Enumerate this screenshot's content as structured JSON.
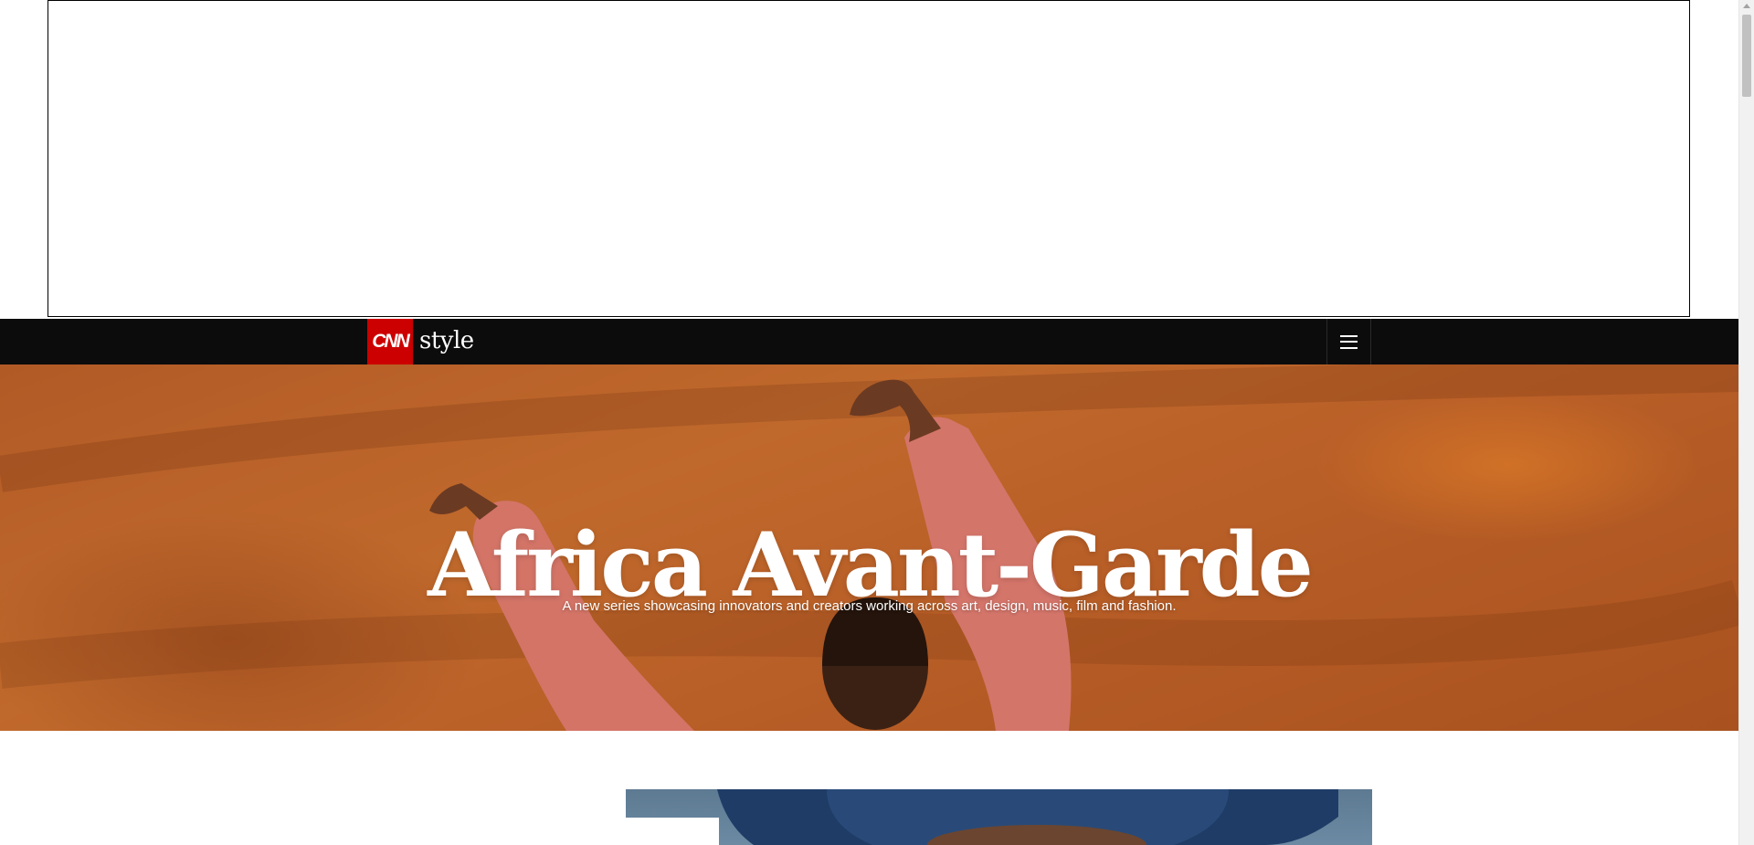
{
  "header": {
    "brand_logo_text": "CNN",
    "brand_section": "style"
  },
  "nav": {
    "menu_icon": "hamburger-menu-icon"
  },
  "hero": {
    "title": "Africa Avant-Garde",
    "subtitle": "A new series showcasing innovators and creators working across art, design, music, film and fashion."
  },
  "colors": {
    "nav_background": "#0c0c0c",
    "cnn_red": "#cc0000",
    "hero_orange": "#b85e27"
  }
}
